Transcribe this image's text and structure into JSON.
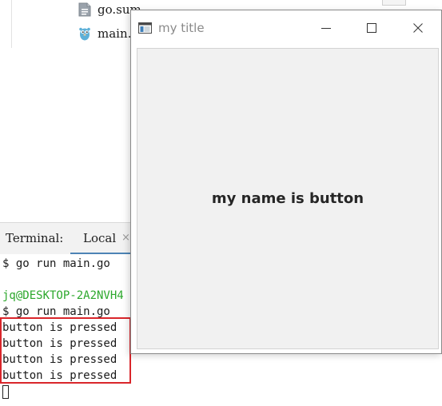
{
  "ide": {
    "tree": [
      {
        "label": "go.sum",
        "icon": "text-file-icon"
      },
      {
        "label": "main.",
        "icon": "gopher-file-icon"
      }
    ],
    "terminal": {
      "title": "Terminal:",
      "tab_label": "Local",
      "tab_close": "×",
      "lines": [
        {
          "text": "$ go run main.go",
          "color": "#1a1a1a"
        },
        {
          "text": "",
          "color": "#1a1a1a"
        },
        {
          "text": "jq@DESKTOP-2A2NVH4",
          "color": "#2da82d"
        },
        {
          "text": "$ go run main.go",
          "color": "#1a1a1a"
        },
        {
          "text": "button is pressed",
          "color": "#1a1a1a"
        },
        {
          "text": "button is pressed",
          "color": "#1a1a1a"
        },
        {
          "text": "button is pressed",
          "color": "#1a1a1a"
        },
        {
          "text": "button is pressed",
          "color": "#1a1a1a"
        }
      ],
      "highlight_color": "#d9262b"
    }
  },
  "window": {
    "title": "my title",
    "icon": "app-window-icon",
    "controls": [
      "minimize-icon",
      "maximize-icon",
      "close-icon"
    ],
    "button_label": "my name is button"
  },
  "colors": {
    "accent_tab": "#4d84b5",
    "prompt_green": "#2da82d",
    "highlight_red": "#d9262b",
    "button_bg": "#f1f1f1"
  }
}
